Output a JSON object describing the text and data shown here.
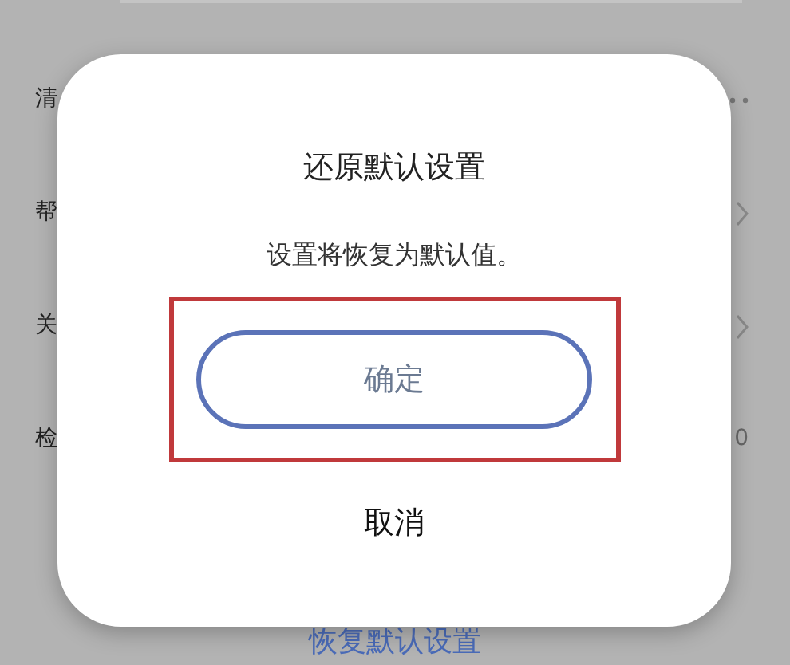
{
  "background": {
    "rows": [
      {
        "label": "清",
        "trailing": {
          "kind": "dots"
        }
      },
      {
        "label": "帮",
        "trailing": {
          "kind": "chevron"
        }
      },
      {
        "label": "关",
        "trailing": {
          "kind": "chevron"
        }
      },
      {
        "label": "检",
        "trailing": {
          "kind": "text",
          "text": "0"
        }
      }
    ],
    "link": "恢复默认设置"
  },
  "dialog": {
    "title": "还原默认设置",
    "message": "设置将恢复为默认值。",
    "buttons": [
      {
        "label": "确定",
        "kind": "primary",
        "highlighted": true
      },
      {
        "label": "取消",
        "kind": "plain",
        "highlighted": false
      }
    ]
  }
}
